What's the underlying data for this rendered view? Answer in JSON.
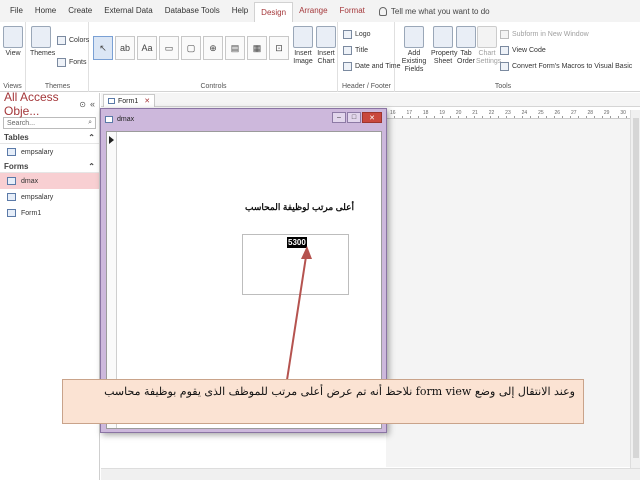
{
  "ribbon_tabs": [
    "File",
    "Home",
    "Create",
    "External Data",
    "Database Tools",
    "Help",
    "Design",
    "Arrange",
    "Format"
  ],
  "active_tab": "Design",
  "tell_me": "Tell me what you want to do",
  "groups": {
    "views": {
      "label": "Views",
      "view_btn": "View"
    },
    "themes": {
      "label": "Themes",
      "themes_btn": "Themes",
      "colors": "Colors",
      "fonts": "Fonts"
    },
    "controls": {
      "label": "Controls",
      "insert_image": "Insert Image",
      "insert_chart": "Insert Chart"
    },
    "header_footer": {
      "label": "Header / Footer",
      "logo": "Logo",
      "title": "Title",
      "date_time": "Date and Time"
    },
    "tools": {
      "label": "Tools",
      "add_fields": "Add Existing Fields",
      "property_sheet": "Property Sheet",
      "tab_order": "Tab Order",
      "chart_settings": "Chart Settings",
      "subform": "Subform in New Window",
      "view_code": "View Code",
      "convert_macros": "Convert Form's Macros to Visual Basic"
    }
  },
  "nav": {
    "title": "All Access Obje...",
    "search_placeholder": "Search...",
    "tables_header": "Tables",
    "tables": [
      "empsalary"
    ],
    "forms_header": "Forms",
    "forms": [
      "dmax",
      "empsalary",
      "Form1"
    ],
    "selected_form": "dmax"
  },
  "doc_tab": "Form1",
  "ruler_numbers": [
    "16",
    "17",
    "18",
    "19",
    "20",
    "21",
    "22",
    "23",
    "24",
    "25",
    "26",
    "27",
    "28",
    "29",
    "30"
  ],
  "form_window": {
    "title": "dmax",
    "label": "أعلى مرتب لوظيفة المحاسب",
    "value": "5300"
  },
  "annotation": "وعند الانتقال إلى وضع form view نلاحظ أنه تم عرض أعلى مرتب للموظف الذى يقوم بوظيفة محاسب",
  "colors": {
    "accent": "#a4373a",
    "annotation_bg": "#fbe3d3",
    "arrow": "#b5534f"
  }
}
